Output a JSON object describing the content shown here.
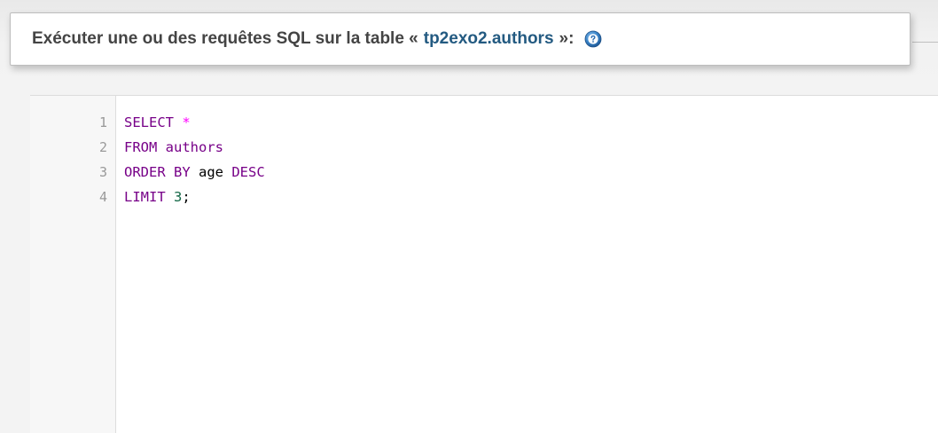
{
  "query_box": {
    "legend_prefix": "Exécuter une ou des requêtes SQL sur la table «",
    "table_name": "tp2exo2.authors",
    "legend_suffix": "»:",
    "help_icon": "help-icon"
  },
  "editor": {
    "line_numbers": [
      "1",
      "2",
      "3",
      "4"
    ],
    "lines": [
      {
        "tokens": [
          {
            "text": "SELECT",
            "type": "keyword"
          },
          {
            "text": " ",
            "type": "plain"
          },
          {
            "text": "*",
            "type": "operator"
          }
        ]
      },
      {
        "tokens": [
          {
            "text": "FROM",
            "type": "keyword"
          },
          {
            "text": " authors",
            "type": "keyword"
          }
        ]
      },
      {
        "tokens": [
          {
            "text": "ORDER BY",
            "type": "keyword"
          },
          {
            "text": " age ",
            "type": "plain"
          },
          {
            "text": "DESC",
            "type": "keyword"
          }
        ]
      },
      {
        "tokens": [
          {
            "text": "LIMIT",
            "type": "keyword"
          },
          {
            "text": " ",
            "type": "plain"
          },
          {
            "text": "3",
            "type": "number"
          },
          {
            "text": ";",
            "type": "plain"
          }
        ]
      }
    ]
  },
  "colors": {
    "keyword": "#770088",
    "operator": "#ff00ff",
    "number": "#116644",
    "link": "#235a81"
  }
}
